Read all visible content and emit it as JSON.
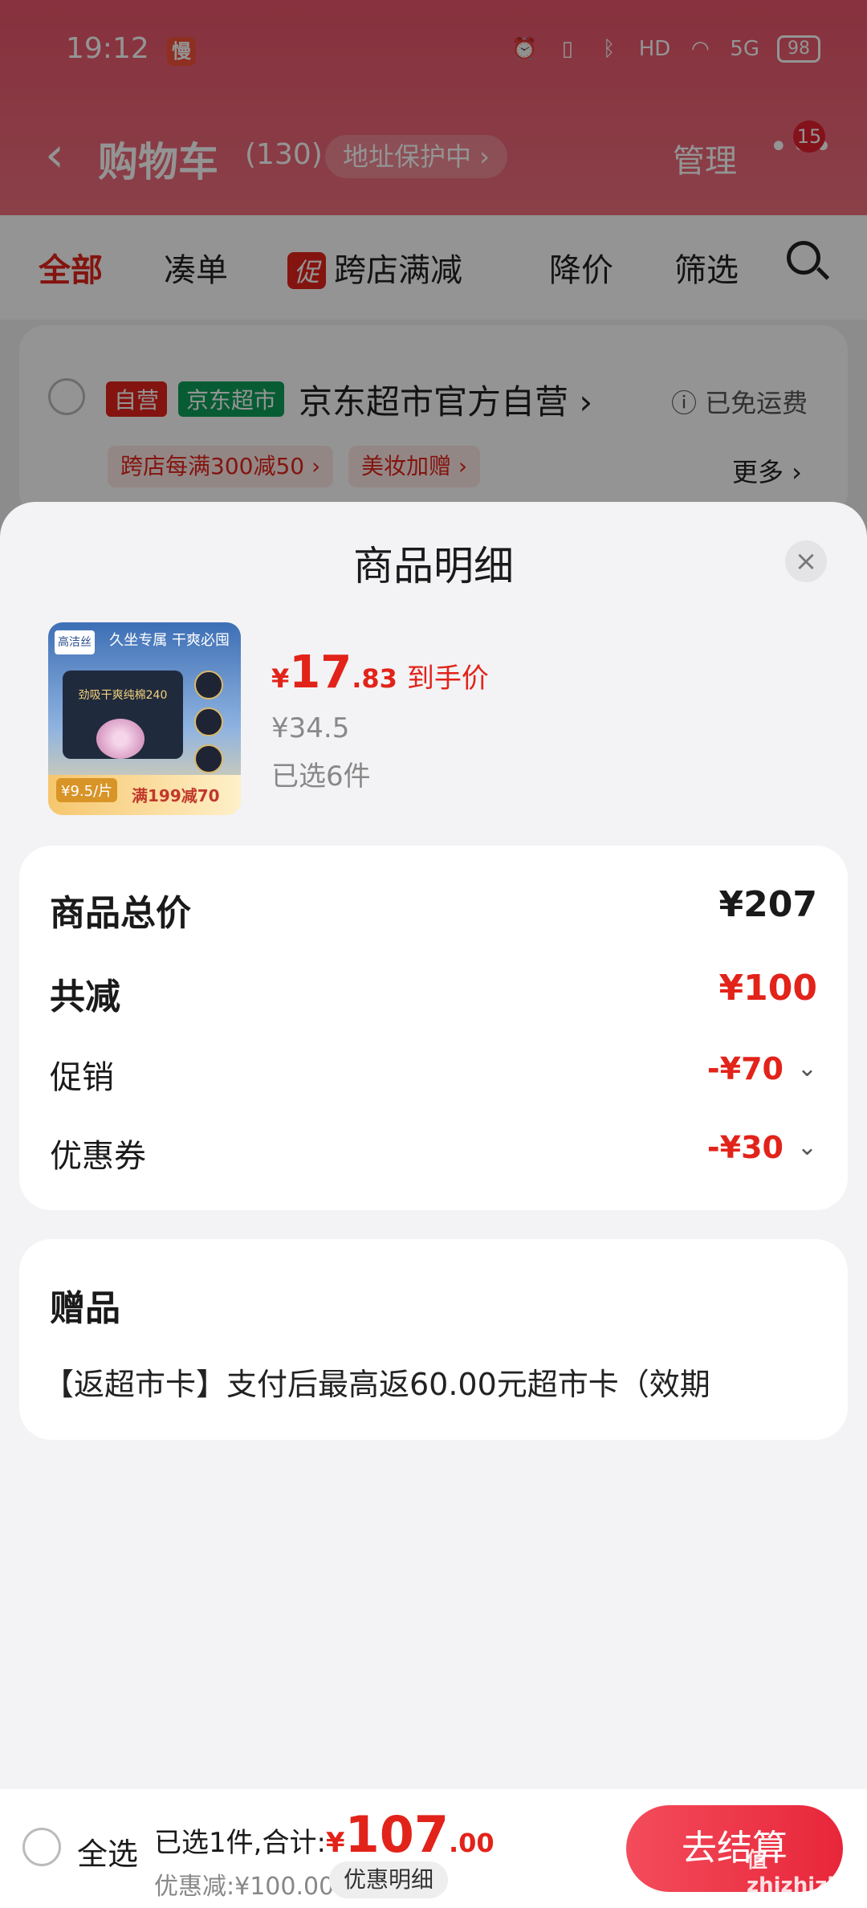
{
  "status": {
    "time": "19:12",
    "battery": "98",
    "network": "5G",
    "hd": "HD"
  },
  "nav": {
    "back_icon": "‹",
    "title": "购物车",
    "count": "(130)",
    "address": "地址保护中 ›",
    "manage": "管理",
    "more_icon": "•••",
    "badge": "15"
  },
  "filters": {
    "all": "全部",
    "bundle": "凑单",
    "promo_tag": "促",
    "cross_store": "跨店满减",
    "price_drop": "降价",
    "filter": "筛选"
  },
  "shop": {
    "tag_self": "自营",
    "tag_jd": "京东超市",
    "name": "京东超市官方自营 ›",
    "shipping": "ⓘ 已免运费",
    "chip1": "跨店每满300减50 ›",
    "chip2": "美妆加赠 ›",
    "more": "更多 ›"
  },
  "sheet": {
    "title": "商品明细",
    "close_icon": "×",
    "product": {
      "img_top": "久坐专属  干爽必囤",
      "img_logo": "高洁丝",
      "img_pack": "劲吸干爽纯棉240",
      "img_price": "¥9.5/片",
      "img_deal": "满199减70",
      "price_yen": "¥",
      "price_int": "17",
      "price_dec": ".83",
      "price_label": "到手价",
      "orig_price": "¥34.5",
      "selected": "已选6件"
    },
    "summary": {
      "total_label": "商品总价",
      "total_value": "¥207",
      "reduce_label": "共减",
      "reduce_value": "¥100",
      "promo_label": "促销",
      "promo_value": "-¥70",
      "coupon_label": "优惠券",
      "coupon_value": "-¥30",
      "chevron_icon": "⌄"
    },
    "gift": {
      "title": "赠品",
      "text": "【返超市卡】支付后最高返60.00元超市卡（效期"
    }
  },
  "bottom": {
    "select_all": "全选",
    "selected_text": "已选1件,合计:",
    "total_yen": "¥",
    "total_int": "107",
    "total_dec": ".00",
    "discount": "优惠减:¥100.00",
    "discount_btn": "优惠明细",
    "checkout": "去结算",
    "watermark": "值 zhizhizhi.com"
  },
  "colors": {
    "accent": "#e2231a",
    "header": "#e8566b",
    "green": "#0e9f5a"
  }
}
